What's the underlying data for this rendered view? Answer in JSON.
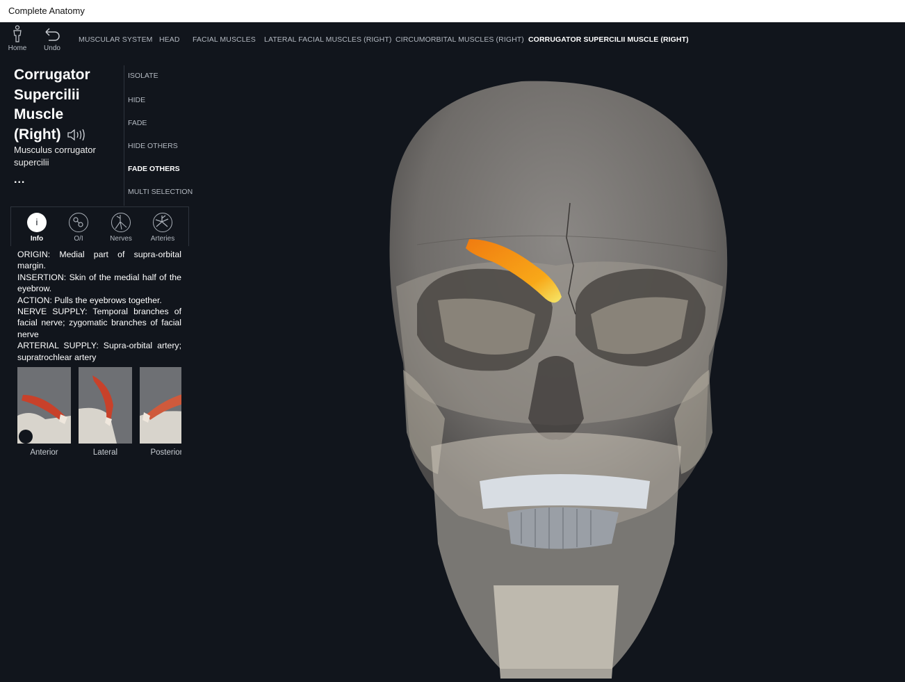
{
  "window": {
    "title": "Complete Anatomy"
  },
  "nav": {
    "home_label": "Home",
    "undo_label": "Undo"
  },
  "breadcrumb": [
    "MUSCULAR SYSTEM",
    "HEAD",
    "FACIAL MUSCLES",
    "LATERAL FACIAL MUSCLES (RIGHT)",
    "CIRCUMORBITAL MUSCLES (RIGHT)",
    "CORRUGATOR SUPERCILII MUSCLE (RIGHT)"
  ],
  "structure": {
    "title": "Corrugator Supercilii Muscle (Right)",
    "title_lines": [
      "Corrugator",
      "Supercilii",
      "Muscle",
      "(Right)"
    ],
    "latin_name": "Musculus corrugator supercilii",
    "more_label": "..."
  },
  "actions": [
    "ISOLATE",
    "HIDE",
    "FADE",
    "HIDE OTHERS",
    "FADE OTHERS",
    "MULTI SELECTION"
  ],
  "active_action": "FADE OTHERS",
  "tabs": [
    {
      "label": "Info",
      "icon": "info-icon",
      "active": true
    },
    {
      "label": "O/I",
      "icon": "origin-insertion-icon",
      "active": false
    },
    {
      "label": "Nerves",
      "icon": "nerves-icon",
      "active": false
    },
    {
      "label": "Arteries",
      "icon": "arteries-icon",
      "active": false
    }
  ],
  "info": {
    "origin": "ORIGIN: Medial part of supra-orbital margin.",
    "insertion": "INSERTION: Skin of the medial half of the eyebrow.",
    "action": "ACTION: Pulls the eyebrows together.",
    "nerve_supply": "NERVE SUPPLY: Temporal branches of facial nerve; zygomatic branches of facial nerve",
    "arterial_supply": "ARTERIAL SUPPLY: Supra-orbital artery; supratrochlear artery"
  },
  "views": [
    "Anterior",
    "Lateral",
    "Posterior"
  ],
  "colors": {
    "background": "#11151c",
    "highlight_muscle": "#f5a010",
    "muscle_thumb": "#c8412a",
    "bone": "#7a7774"
  }
}
